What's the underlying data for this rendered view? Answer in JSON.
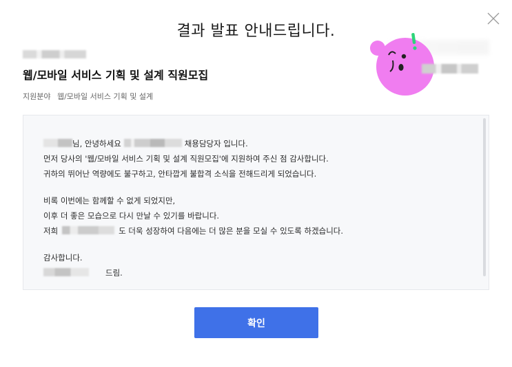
{
  "dialog": {
    "title": "결과 발표 안내드립니다.",
    "job_title": "웹/모바일 서비스 기획 및 설계 직원모집",
    "field_label": "지원분야",
    "field_value": "웹/모바일 서비스 기획 및 설계"
  },
  "letter": {
    "line1_a": "님, 안녕하세요",
    "line1_b": "채용담당자 입니다.",
    "line2": "먼저 당사의 '웹/모바일 서비스 기획 및 설계 직원모집'에 지원하여 주신 점 감사합니다.",
    "line3": "귀하의 뛰어난 역량에도 불구하고, 안타깝게 불합격 소식을 전해드리게 되었습니다.",
    "line4": "비록 이번에는 함께할 수 없게 되었지만,",
    "line5": "이후 더 좋은 모습으로 다시 만날 수 있기를 바랍니다.",
    "line6_a": "저희",
    "line6_b": "도 더욱 성장하여 다음에는 더 많은 분을 모실 수 있도록 하겠습니다.",
    "line7": "감사합니다.",
    "line8": "드림."
  },
  "buttons": {
    "confirm": "확인"
  },
  "icons": {
    "close": "close-icon",
    "mascot": "mascot-illustration"
  },
  "colors": {
    "accent": "#3f71e8",
    "mascot_pink": "#f07df0",
    "exclaim_green": "#2ed47a"
  }
}
